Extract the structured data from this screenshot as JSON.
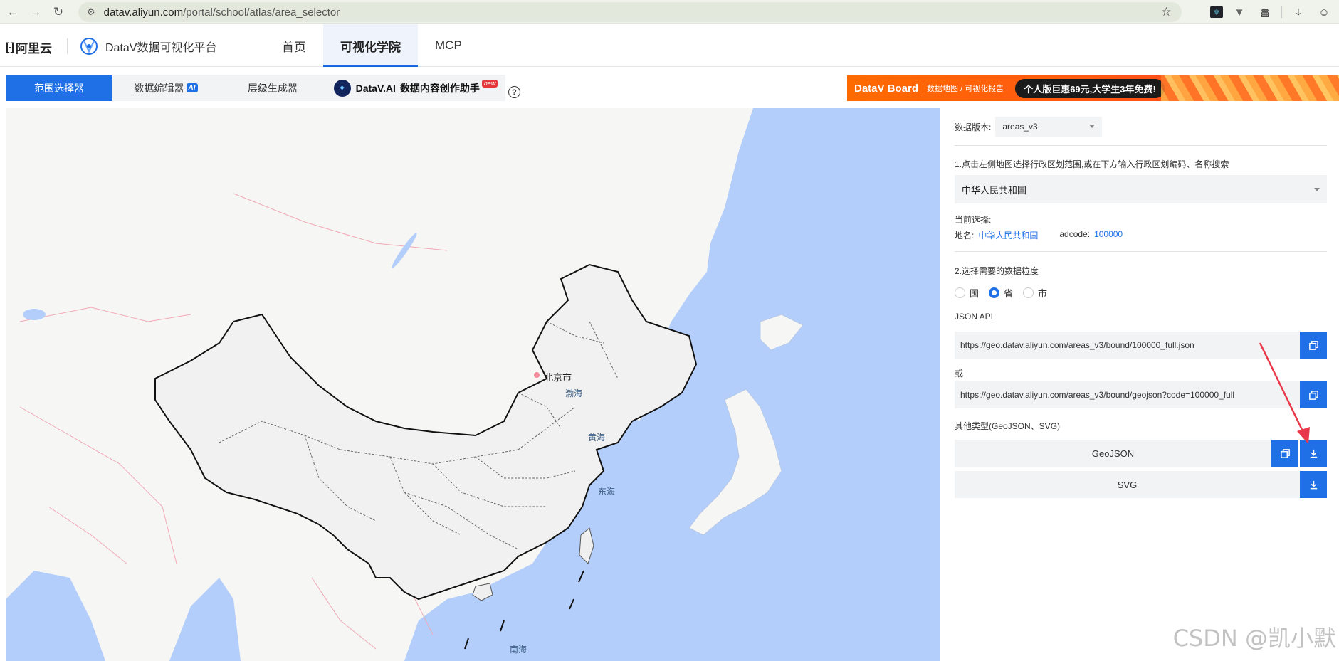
{
  "browser": {
    "url_host": "datav.aliyun.com",
    "url_path": "/portal/school/atlas/area_selector"
  },
  "header": {
    "aliyun_logo": "阿里云",
    "aliyun_mark": "[-]",
    "datav_logo": "DataV数据可视化平台",
    "nav": [
      {
        "label": "首页",
        "active": false
      },
      {
        "label": "可视化学院",
        "active": true
      },
      {
        "label": "MCP",
        "active": false
      }
    ]
  },
  "tabs": {
    "range_selector": "范围选择器",
    "data_editor": "数据编辑器",
    "data_editor_badge": "AI",
    "level_generator": "层级生成器",
    "datav_ai": "DataV.AI",
    "datav_ai_desc": "数据内容创作助手",
    "datav_ai_badge": "new",
    "help": "?"
  },
  "banner": {
    "title": "DataV Board",
    "subtitle": "数据地图 / 可视化报告",
    "promo": "个人版巨惠69元,大学生3年免费!"
  },
  "map": {
    "labels": {
      "beijing": "北京市",
      "bohai": "渤海",
      "huanghai": "黄海",
      "donghai": "东海",
      "nanhai": "南海"
    },
    "colors": {
      "water": "#b3cefa",
      "land": "#f6f6f4",
      "china": "#f0f0f0",
      "border": "#111111",
      "intl_border": "#f0a9b6"
    }
  },
  "panel": {
    "version_label": "数据版本:",
    "version_value": "areas_v3",
    "step1": "1.点击左侧地图选择行政区划范围,或在下方输入行政区划编码、名称搜索",
    "search_value": "中华人民共和国",
    "current_label": "当前选择:",
    "place_label": "地名:",
    "place_value": "中华人民共和国",
    "adcode_label": "adcode:",
    "adcode_value": "100000",
    "step2": "2.选择需要的数据粒度",
    "granularity": [
      {
        "label": "国",
        "checked": false
      },
      {
        "label": "省",
        "checked": true
      },
      {
        "label": "市",
        "checked": false
      }
    ],
    "json_api_label": "JSON API",
    "json_api_url": "https://geo.datav.aliyun.com/areas_v3/bound/100000_full.json",
    "or_label": "或",
    "geojson_url": "https://geo.datav.aliyun.com/areas_v3/bound/geojson?code=100000_full",
    "other_types_label": "其他类型(GeoJSON、SVG)",
    "geojson_label": "GeoJSON",
    "svg_label": "SVG"
  },
  "watermark": "CSDN @凯小默"
}
